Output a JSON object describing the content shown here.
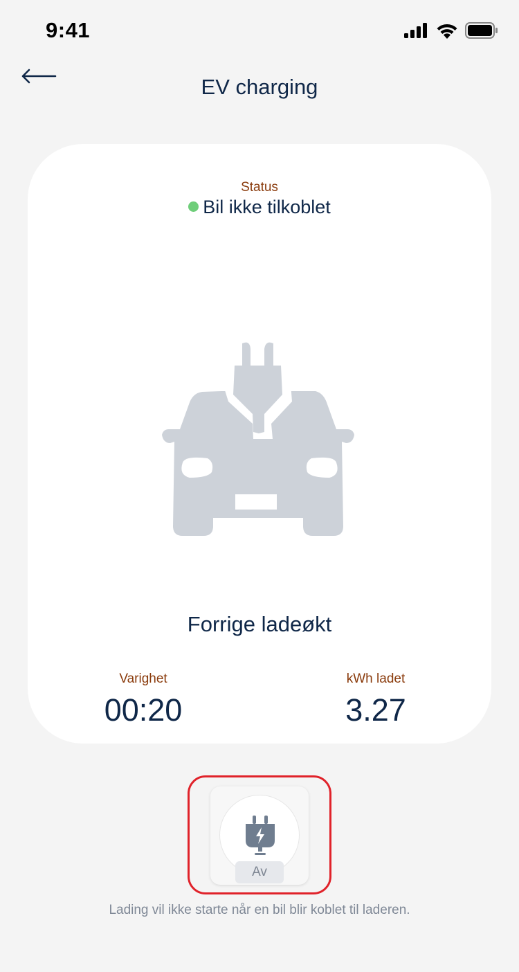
{
  "status_bar": {
    "time": "9:41"
  },
  "header": {
    "title": "EV charging"
  },
  "status": {
    "label": "Status",
    "value": "Bil ikke tilkoblet",
    "indicator_color": "#6fce7a"
  },
  "previous_session": {
    "title": "Forrige ladeøkt",
    "duration": {
      "label": "Varighet",
      "value": "00:20"
    },
    "energy": {
      "label": "kWh ladet",
      "value": "3.27"
    }
  },
  "charging_toggle": {
    "icon": "plug-bolt-icon",
    "state_label": "Av"
  },
  "hint_text": "Lading vil ikke starte når en bil blir koblet til laderen."
}
